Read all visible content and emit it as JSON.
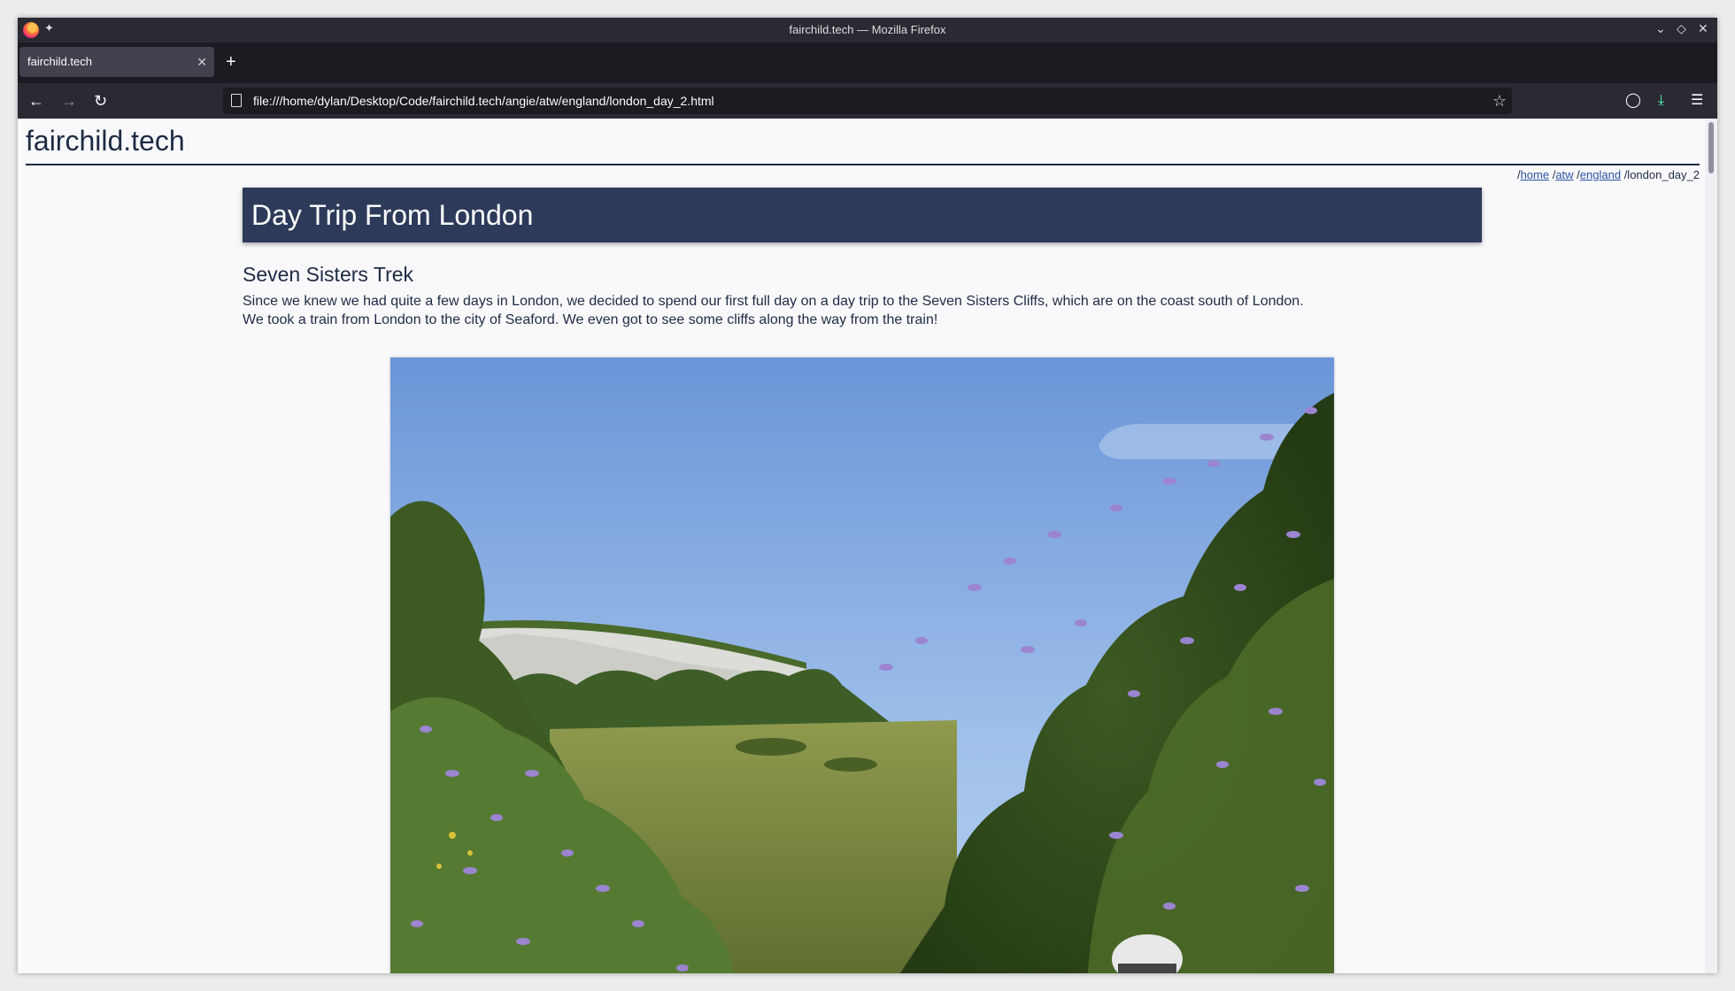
{
  "window": {
    "title": "fairchild.tech — Mozilla Firefox"
  },
  "tabs": [
    {
      "label": "fairchild.tech",
      "active": true
    }
  ],
  "icons": {
    "pin": "pin-icon",
    "minimize": "chevron-down-icon",
    "maximize": "diamond-icon",
    "close": "close-icon",
    "back": "back-arrow-icon",
    "forward": "forward-arrow-icon",
    "reload": "reload-icon",
    "bookmark": "star-icon",
    "pocket": "pocket-icon",
    "downloads": "download-icon",
    "menu": "hamburger-menu-icon"
  },
  "urlbar": {
    "url": "file:///home/dylan/Desktop/Code/fairchild.tech/angie/atw/england/london_day_2.html"
  },
  "site": {
    "title": "fairchild.tech"
  },
  "breadcrumb": {
    "sep1": "/",
    "home": "home",
    "sep2": " /",
    "atw": "atw",
    "sep3": " /",
    "england": "england",
    "current": " /london_day_2"
  },
  "page": {
    "heading": "Day Trip From London",
    "section_title": "Seven Sisters Trek",
    "paragraph_line1": "Since we knew we had quite a few days in London, we decided to spend our first full day on a day trip to the Seven Sisters Cliffs, which are on the coast south of London.",
    "paragraph_line2": "We took a train from London to the city of Seaford. We even got to see some cliffs along the way from the train!"
  },
  "colors": {
    "banner": "#2d3a5a",
    "text": "#1e2b45",
    "link": "#2a52a3"
  }
}
